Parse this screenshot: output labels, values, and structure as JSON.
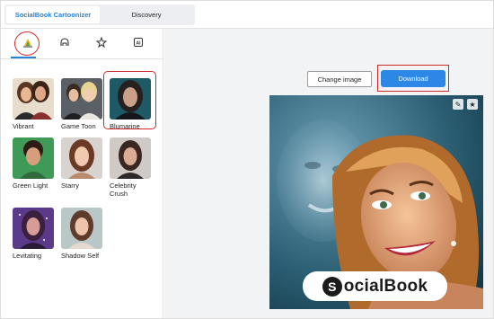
{
  "tabs": [
    {
      "label": "SocialBook Cartoonizer"
    },
    {
      "label": "Discovery"
    }
  ],
  "icon_tabs": [
    {
      "icon": "cartoon-triangle-icon"
    },
    {
      "icon": "helmet-icon"
    },
    {
      "icon": "sparkle-star-icon"
    },
    {
      "icon": "ai-icon"
    }
  ],
  "styles": [
    {
      "label": "Vibrant"
    },
    {
      "label": "Game Toon"
    },
    {
      "label": "Blumarine"
    },
    {
      "label": "Green Light"
    },
    {
      "label": "Starry"
    },
    {
      "label": "Celebrity Crush"
    },
    {
      "label": "Levitating"
    },
    {
      "label": "Shadow Self"
    }
  ],
  "actions": {
    "change_image": "Change image",
    "download": "Download"
  },
  "result": {
    "edit_icon": "edit-icon",
    "favorite_icon": "star-icon",
    "watermark_mark": "S",
    "watermark_text": "ocialBook"
  },
  "colors": {
    "accent": "#2684d8",
    "download_bg": "#2c87e6",
    "highlight": "#cf2a2a"
  }
}
